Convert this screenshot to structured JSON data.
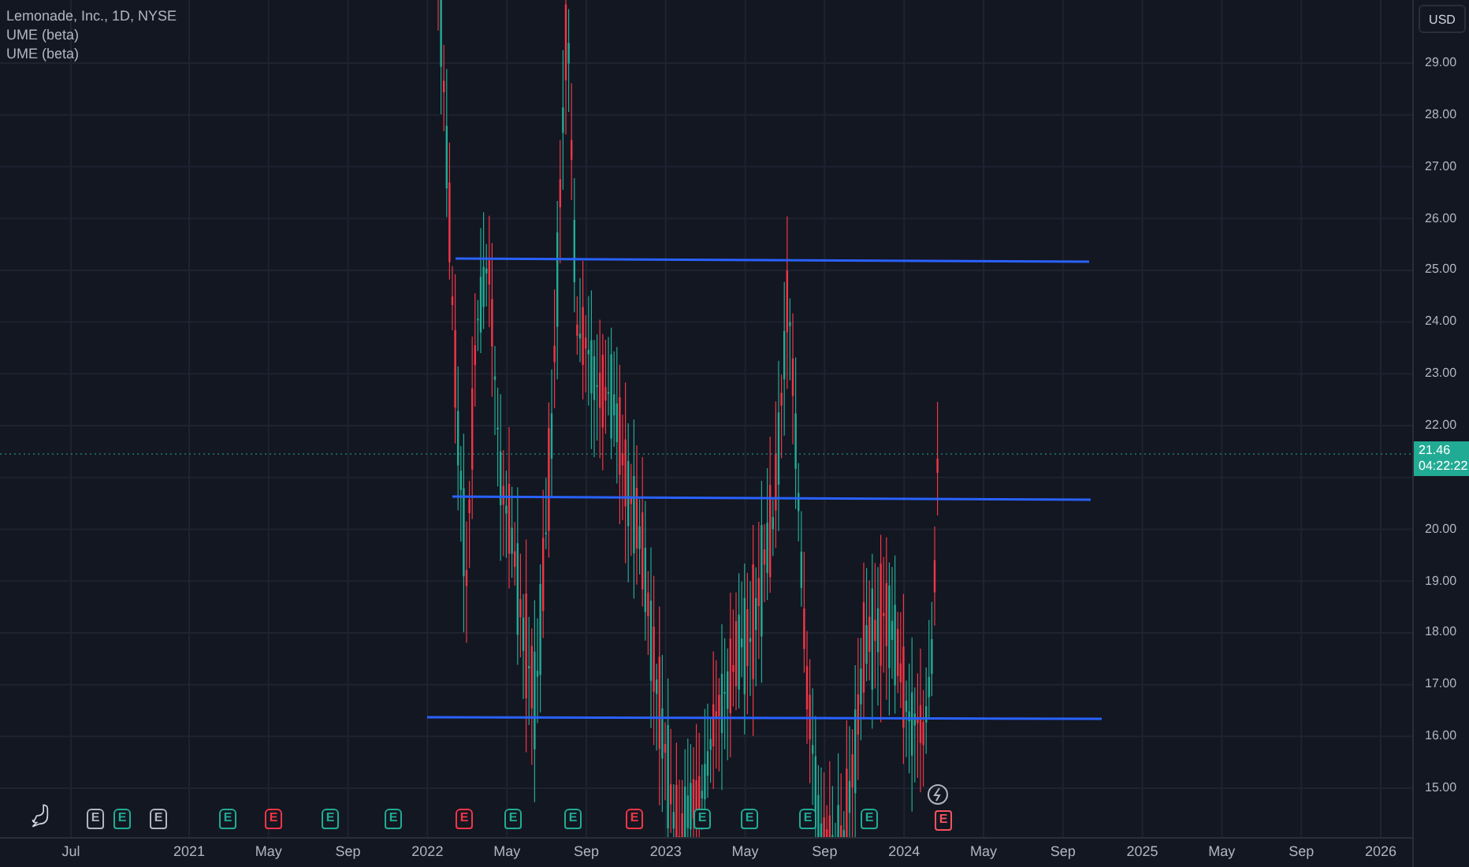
{
  "legend": {
    "title": "Lemonade, Inc., 1D, NYSE",
    "indicators": [
      "UME (beta)",
      "UME (beta)"
    ]
  },
  "price_axis": {
    "currency": "USD",
    "ticks": [
      "29.00",
      "28.00",
      "27.00",
      "26.00",
      "25.00",
      "24.00",
      "23.00",
      "22.00",
      "20.00",
      "19.00",
      "18.00",
      "17.00",
      "16.00",
      "15.00"
    ],
    "last_price": "21.46",
    "countdown": "04:22:22"
  },
  "time_axis": {
    "ticks": [
      "Jul",
      "2021",
      "May",
      "Sep",
      "2022",
      "May",
      "Sep",
      "2023",
      "May",
      "Sep",
      "2024",
      "May",
      "Sep",
      "2025",
      "May",
      "Sep",
      "2026"
    ]
  },
  "events": [
    {
      "kind": "logo"
    },
    {
      "kind": "earnings",
      "label": "E",
      "color": "#b2b5be"
    },
    {
      "kind": "earnings",
      "label": "E",
      "color": "#22ab94"
    },
    {
      "kind": "earnings",
      "label": "E",
      "color": "#b2b5be"
    },
    {
      "kind": "earnings",
      "label": "E",
      "color": "#22ab94"
    },
    {
      "kind": "earnings",
      "label": "E",
      "color": "#f23645"
    },
    {
      "kind": "earnings",
      "label": "E",
      "color": "#22ab94"
    },
    {
      "kind": "earnings",
      "label": "E",
      "color": "#22ab94"
    },
    {
      "kind": "earnings",
      "label": "E",
      "color": "#f23645"
    },
    {
      "kind": "earnings",
      "label": "E",
      "color": "#22ab94"
    },
    {
      "kind": "earnings",
      "label": "E",
      "color": "#22ab94"
    },
    {
      "kind": "earnings",
      "label": "E",
      "color": "#f23645"
    },
    {
      "kind": "earnings",
      "label": "E",
      "color": "#22ab94"
    },
    {
      "kind": "earnings",
      "label": "E",
      "color": "#22ab94"
    },
    {
      "kind": "earnings",
      "label": "E",
      "color": "#22ab94"
    },
    {
      "kind": "earnings",
      "label": "E",
      "color": "#22ab94"
    },
    {
      "kind": "upcoming",
      "label": "E",
      "color": "#f7525f"
    }
  ]
}
